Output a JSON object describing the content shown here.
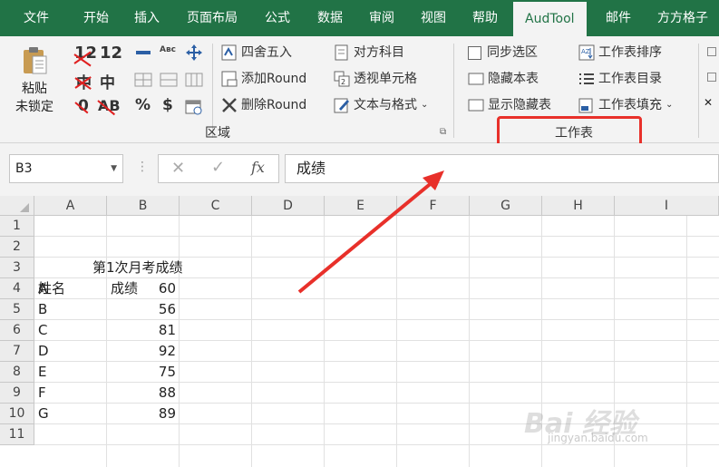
{
  "tabs": [
    "文件",
    "开始",
    "插入",
    "页面布局",
    "公式",
    "数据",
    "审阅",
    "视图",
    "帮助",
    "AudTool",
    "邮件",
    "方方格子"
  ],
  "active_tab": "AudTool",
  "ribbon": {
    "paste_unlocked_line1": "粘贴",
    "paste_unlocked_line2": "未锁定",
    "numbers": {
      "n12a": "12",
      "n12b": "12",
      "zhong": "中",
      "zero": "0",
      "ab": "AB",
      "percent": "%",
      "dollar": "$"
    },
    "round": {
      "four_five": "四舍五入",
      "add": "添加Round",
      "delete": "删除Round"
    },
    "cells": {
      "contra": "对方科目",
      "transparent": "透视单元格",
      "text_format": "文本与格式"
    },
    "region_label": "区域",
    "sheet": {
      "sync": "同步选区",
      "hide_sheet": "隐藏本表",
      "show_hidden": "显示隐藏表"
    },
    "worksheet": {
      "sort": "工作表排序",
      "dir": "工作表目录",
      "fill": "工作表填充"
    },
    "sheet_label": "工作表"
  },
  "formula_bar": {
    "namebox": "B3",
    "content": "成绩",
    "fx": "fx"
  },
  "columns": [
    "A",
    "B",
    "C",
    "D",
    "E",
    "F",
    "G",
    "H",
    "I"
  ],
  "rows": [
    "1",
    "2",
    "3",
    "4",
    "5",
    "6",
    "7",
    "8",
    "9",
    "10",
    "11"
  ],
  "sheet_title": "第1次月考成绩",
  "header_row": {
    "name": "姓名",
    "score": "成绩"
  },
  "records": [
    {
      "name": "A",
      "score": "60"
    },
    {
      "name": "B",
      "score": "56"
    },
    {
      "name": "C",
      "score": "81"
    },
    {
      "name": "D",
      "score": "92"
    },
    {
      "name": "E",
      "score": "75"
    },
    {
      "name": "F",
      "score": "88"
    },
    {
      "name": "G",
      "score": "89"
    }
  ],
  "watermark": {
    "main": "Bai 经验",
    "sub": "jingyan.baidu.com"
  },
  "colors": {
    "excel_green": "#217346",
    "highlight_red": "#e8302a"
  }
}
